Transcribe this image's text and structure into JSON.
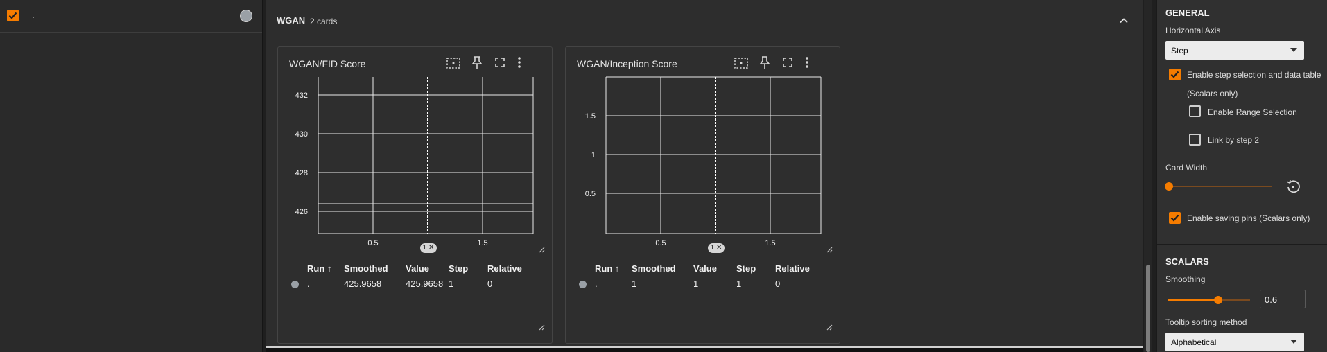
{
  "runs": {
    "items": [
      {
        "label": "."
      }
    ]
  },
  "group": {
    "title": "WGAN",
    "count": "2 cards"
  },
  "cards": [
    {
      "title": "WGAN/FID Score",
      "y_ticks": [
        "432",
        "430",
        "428",
        "426"
      ],
      "x_ticks": [
        "0.5",
        "1.5"
      ],
      "step_chip": "1 ✕",
      "table": {
        "headers": [
          "Run ↑",
          "Smoothed",
          "Value",
          "Step",
          "Relative"
        ],
        "row": {
          "run": ".",
          "smoothed": "425.9658",
          "value": "425.9658",
          "step": "1",
          "relative": "0"
        }
      }
    },
    {
      "title": "WGAN/Inception Score",
      "y_ticks": [
        "1.5",
        "1",
        "0.5"
      ],
      "x_ticks": [
        "0.5",
        "1.5"
      ],
      "step_chip": "1 ✕",
      "table": {
        "headers": [
          "Run ↑",
          "Smoothed",
          "Value",
          "Step",
          "Relative"
        ],
        "row": {
          "run": ".",
          "smoothed": "1",
          "value": "1",
          "step": "1",
          "relative": "0"
        }
      }
    }
  ],
  "settings": {
    "general_title": "GENERAL",
    "horizontal_axis_label": "Horizontal Axis",
    "horizontal_axis_value": "Step",
    "step_selection_label": "Enable step selection and data table",
    "step_selection_sub": "(Scalars only)",
    "range_selection_label": "Enable Range Selection",
    "link_by_step_label": "Link by step 2",
    "card_width_label": "Card Width",
    "card_width_level": 0.0,
    "saving_pins_label": "Enable saving pins (Scalars only)",
    "scalars_title": "SCALARS",
    "smoothing_label": "Smoothing",
    "smoothing_value": "0.6",
    "tooltip_sort_label": "Tooltip sorting method",
    "tooltip_sort_value": "Alphabetical"
  },
  "colors": {
    "accent": "#f57c00",
    "run_dot": "#9aa0a6"
  },
  "icons": [
    "check-icon",
    "fit-domain-icon",
    "pin-icon",
    "fullscreen-icon",
    "more-vert-icon",
    "chevron-up-icon",
    "reset-icon",
    "dropdown-arrow-icon",
    "resize-handle-icon"
  ]
}
